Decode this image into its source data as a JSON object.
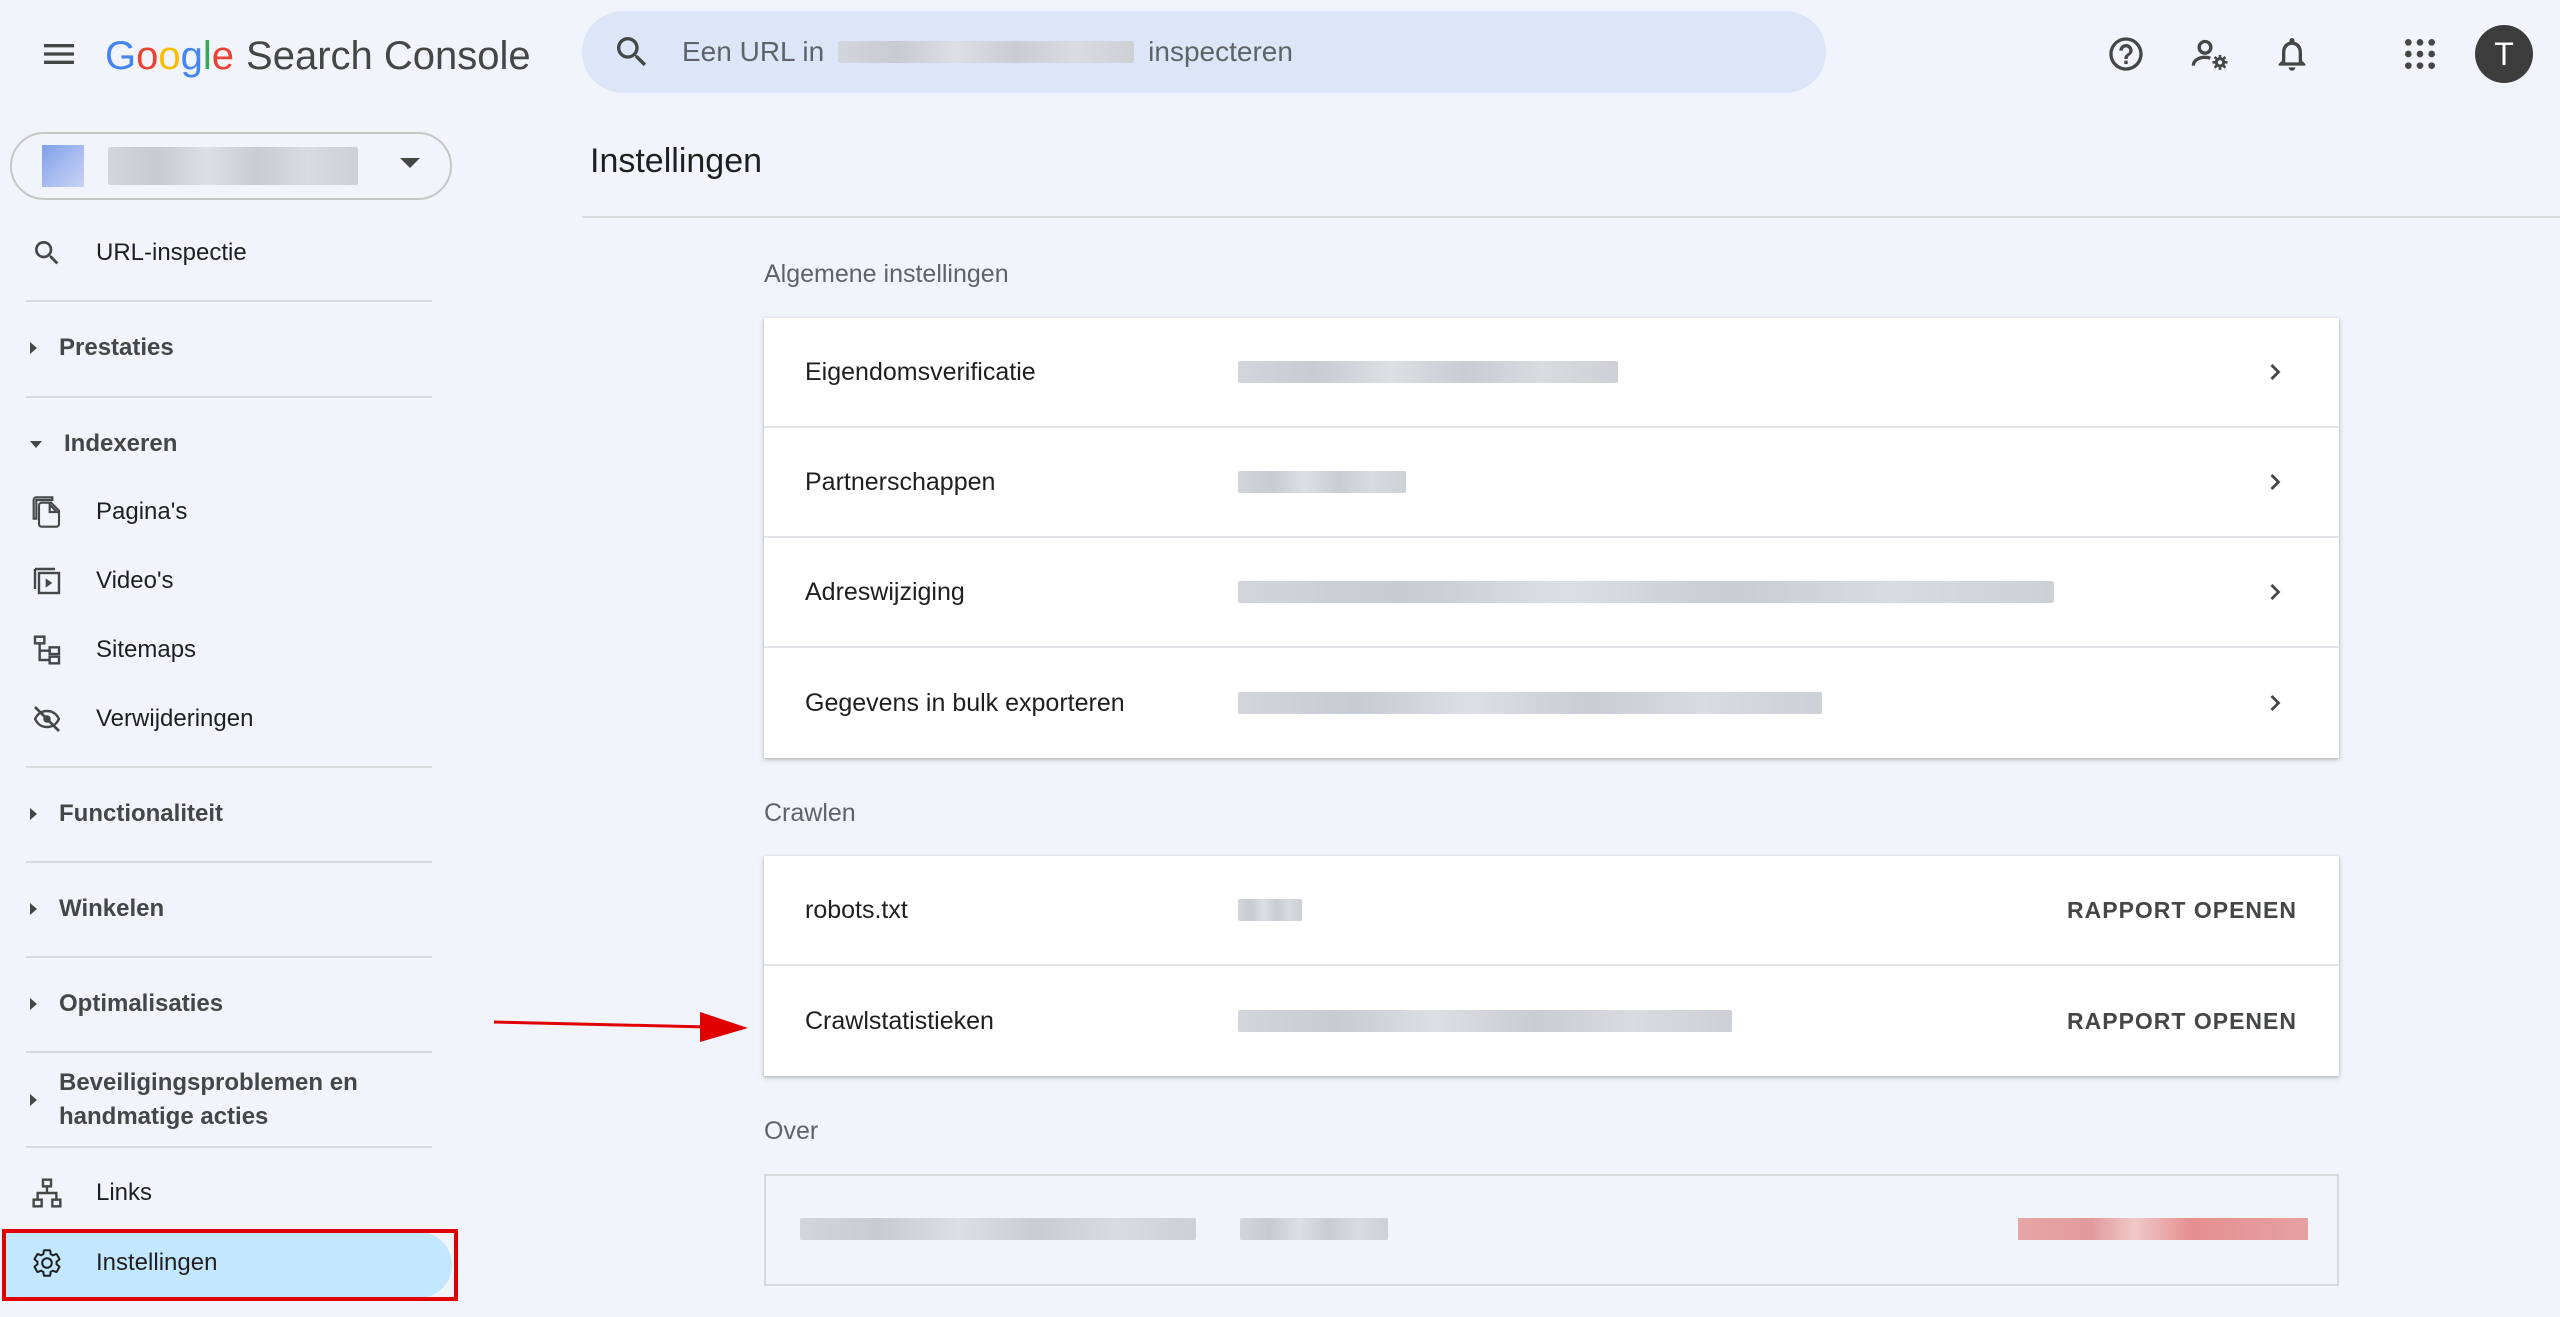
{
  "app": {
    "logo_letters": [
      "G",
      "o",
      "o",
      "g",
      "l",
      "e"
    ],
    "product_name": "Search Console"
  },
  "search": {
    "placeholder_prefix": "Een URL in",
    "placeholder_suffix": "inspecteren"
  },
  "header": {
    "avatar_initial": "T",
    "icons": [
      "help-icon",
      "manage-users-icon",
      "notifications-icon",
      "apps-grid-icon"
    ]
  },
  "sidebar": {
    "url_inspection": "URL-inspectie",
    "sections": {
      "performance": "Prestaties",
      "indexing": "Indexeren",
      "functionality": "Functionaliteit",
      "shopping": "Winkelen",
      "enhancements": "Optimalisaties",
      "security_line1": "Beveiligingsproblemen en",
      "security_line2": "handmatige acties"
    },
    "indexing_items": [
      "Pagina's",
      "Video's",
      "Sitemaps",
      "Verwijderingen"
    ],
    "links": "Links",
    "settings": "Instellingen"
  },
  "main": {
    "title": "Instellingen",
    "general": {
      "label": "Algemene instellingen",
      "rows": [
        "Eigendomsverificatie",
        "Partnerschappen",
        "Adreswijziging",
        "Gegevens in bulk exporteren"
      ]
    },
    "crawling": {
      "label": "Crawlen",
      "rows": [
        "robots.txt",
        "Crawlstatistieken"
      ],
      "action_label": "RAPPORT OPENEN"
    },
    "about": {
      "label": "Over"
    }
  },
  "colors": {
    "background": "#f1f4fa",
    "active_nav": "#c2e7ff",
    "search_bg": "#dde6f8",
    "annotation_red": "#e00000"
  }
}
